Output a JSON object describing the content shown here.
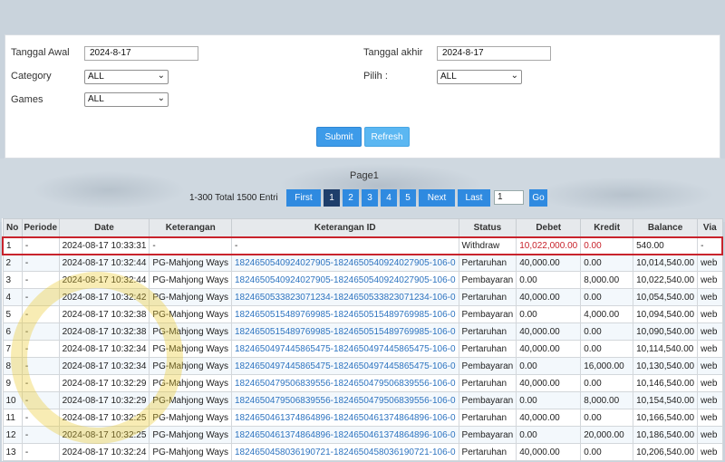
{
  "filters": {
    "tanggal_awal_label": "Tanggal Awal",
    "tanggal_awal_value": "2024-8-17",
    "tanggal_akhir_label": "Tanggal akhir",
    "tanggal_akhir_value": "2024-8-17",
    "category_label": "Category",
    "category_value": "ALL",
    "pilih_label": "Pilih :",
    "pilih_value": "ALL",
    "games_label": "Games",
    "games_value": "ALL",
    "submit_label": "Submit",
    "refresh_label": "Refresh"
  },
  "pager": {
    "title": "Page1",
    "total_info": "1-300 Total 1500 Entri",
    "first": "First",
    "pages": [
      "1",
      "2",
      "3",
      "4",
      "5"
    ],
    "next": "Next",
    "last": "Last",
    "page_input": "1",
    "go": "Go"
  },
  "table": {
    "headers": [
      "No",
      "Periode",
      "Date",
      "Keterangan",
      "Keterangan ID",
      "Status",
      "Debet",
      "Kredit",
      "Balance",
      "Via"
    ],
    "rows": [
      [
        "1",
        "-",
        "2024-08-17 10:33:31",
        "-",
        "-",
        "Withdraw",
        "10,022,000.00",
        "0.00",
        "540.00",
        "-"
      ],
      [
        "2",
        "-",
        "2024-08-17 10:32:44",
        "PG-Mahjong Ways",
        "182465054092402790​5-1824650540924027905-106-0",
        "Pertaruhan",
        "40,000.00",
        "0.00",
        "10,014,540.00",
        "web"
      ],
      [
        "3",
        "-",
        "2024-08-17 10:32:44",
        "PG-Mahjong Ways",
        "1824650540924027905-1824650540924027905-106-0",
        "Pembayaran",
        "0.00",
        "8,000.00",
        "10,022,540.00",
        "web"
      ],
      [
        "4",
        "-",
        "2024-08-17 10:32:42",
        "PG-Mahjong Ways",
        "1824650533823071234-1824650533823071234-106-0",
        "Pertaruhan",
        "40,000.00",
        "0.00",
        "10,054,540.00",
        "web"
      ],
      [
        "5",
        "-",
        "2024-08-17 10:32:38",
        "PG-Mahjong Ways",
        "1824650515489769985-1824650515489769985-106-0",
        "Pembayaran",
        "0.00",
        "4,000.00",
        "10,094,540.00",
        "web"
      ],
      [
        "6",
        "-",
        "2024-08-17 10:32:38",
        "PG-Mahjong Ways",
        "1824650515489769985-1824650515489769985-106-0",
        "Pertaruhan",
        "40,000.00",
        "0.00",
        "10,090,540.00",
        "web"
      ],
      [
        "7",
        "-",
        "2024-08-17 10:32:34",
        "PG-Mahjong Ways",
        "1824650497445865475-1824650497445865475-106-0",
        "Pertaruhan",
        "40,000.00",
        "0.00",
        "10,114,540.00",
        "web"
      ],
      [
        "8",
        "-",
        "2024-08-17 10:32:34",
        "PG-Mahjong Ways",
        "1824650497445865475-1824650497445865475-106-0",
        "Pembayaran",
        "0.00",
        "16,000.00",
        "10,130,540.00",
        "web"
      ],
      [
        "9",
        "-",
        "2024-08-17 10:32:29",
        "PG-Mahjong Ways",
        "1824650479506839556-1824650479506839556-106-0",
        "Pertaruhan",
        "40,000.00",
        "0.00",
        "10,146,540.00",
        "web"
      ],
      [
        "10",
        "-",
        "2024-08-17 10:32:29",
        "PG-Mahjong Ways",
        "1824650479506839556-1824650479506839556-106-0",
        "Pembayaran",
        "0.00",
        "8,000.00",
        "10,154,540.00",
        "web"
      ],
      [
        "11",
        "-",
        "2024-08-17 10:32:25",
        "PG-Mahjong Ways",
        "1824650461374864896-1824650461374864896-106-0",
        "Pertaruhan",
        "40,000.00",
        "0.00",
        "10,166,540.00",
        "web"
      ],
      [
        "12",
        "-",
        "2024-08-17 10:32:25",
        "PG-Mahjong Ways",
        "1824650461374864896-1824650461374864896-106-0",
        "Pembayaran",
        "0.00",
        "20,000.00",
        "10,186,540.00",
        "web"
      ],
      [
        "13",
        "-",
        "2024-08-17 10:32:24",
        "PG-Mahjong Ways",
        "1824650458036190721-1824650458036190721-106-0",
        "Pertaruhan",
        "40,000.00",
        "0.00",
        "10,206,540.00",
        "web"
      ]
    ]
  }
}
